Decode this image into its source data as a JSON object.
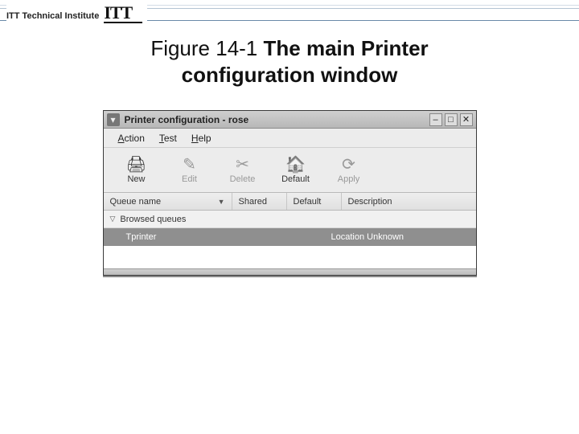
{
  "brand": {
    "name": "ITT Technical Institute",
    "logo": "ITT"
  },
  "caption": {
    "figure": "Figure 14-1",
    "title_1": "The main Printer",
    "title_2": "configuration window"
  },
  "window": {
    "title": "Printer configuration - rose",
    "controls": {
      "minimize": "–",
      "maximize": "□",
      "close": "✕"
    },
    "menubar": {
      "action": "Action",
      "test": "Test",
      "help": "Help"
    },
    "toolbar": {
      "new": {
        "label": "New",
        "icon": "🖨"
      },
      "edit": {
        "label": "Edit",
        "icon": "✎"
      },
      "delete": {
        "label": "Delete",
        "icon": "✂"
      },
      "default": {
        "label": "Default",
        "icon": "🏠"
      },
      "apply": {
        "label": "Apply",
        "icon": "⟳"
      }
    },
    "headers": {
      "queue_name": "Queue name",
      "shared": "Shared",
      "default": "Default",
      "description": "Description"
    },
    "section": {
      "label": "Browsed queues"
    },
    "rows": [
      {
        "name": "Tprinter",
        "description": "Location Unknown"
      }
    ]
  }
}
